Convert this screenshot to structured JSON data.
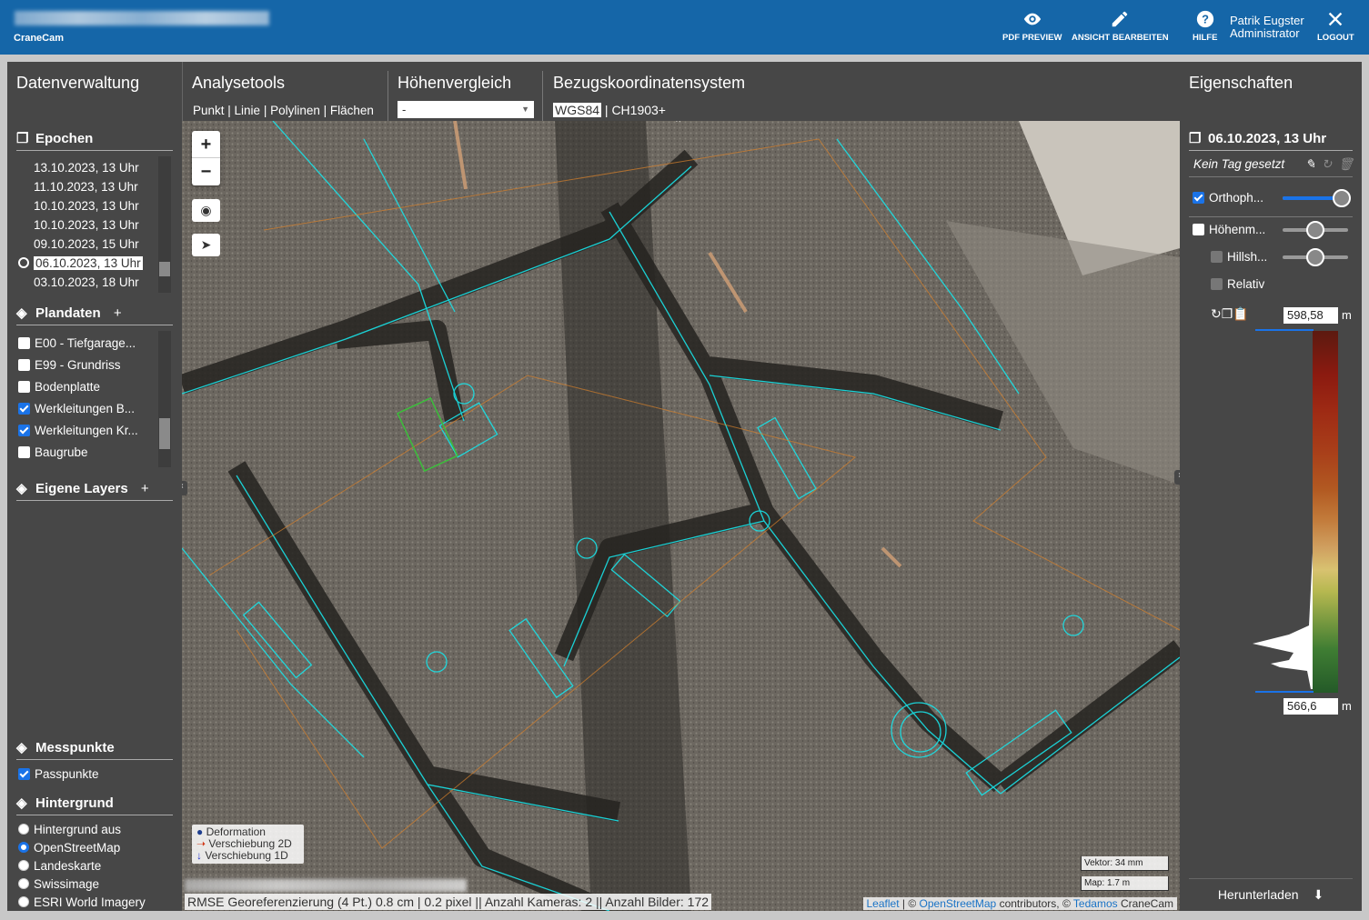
{
  "app": {
    "brand": "CraneCam"
  },
  "topbar": {
    "pdf_preview": "PDF PREVIEW",
    "edit_view": "ANSICHT BEARBEITEN",
    "help": "HILFE",
    "user_name": "Patrik Eugster",
    "user_role": "Administrator",
    "logout": "LOGOUT"
  },
  "left": {
    "title": "Datenverwaltung",
    "epochs": {
      "label": "Epochen",
      "items": [
        "13.10.2023, 13 Uhr",
        "11.10.2023, 13 Uhr",
        "10.10.2023, 13 Uhr",
        "10.10.2023, 13 Uhr",
        "09.10.2023, 15 Uhr",
        "06.10.2023, 13 Uhr",
        "03.10.2023, 18 Uhr"
      ],
      "selected_index": 5
    },
    "plans": {
      "label": "Plandaten",
      "add": "+",
      "items": [
        {
          "label": "E00 - Tiefgarage...",
          "checked": false
        },
        {
          "label": "E99 - Grundriss",
          "checked": false
        },
        {
          "label": "Bodenplatte",
          "checked": false
        },
        {
          "label": "Werkleitungen B...",
          "checked": true
        },
        {
          "label": "Werkleitungen Kr...",
          "checked": true
        },
        {
          "label": "Baugrube",
          "checked": false
        }
      ]
    },
    "own_layers": {
      "label": "Eigene Layers",
      "add": "+"
    },
    "measure": {
      "label": "Messpunkte",
      "items": [
        {
          "label": "Passpunkte",
          "checked": true
        }
      ]
    },
    "background": {
      "label": "Hintergrund",
      "items": [
        "Hintergrund aus",
        "OpenStreetMap",
        "Landeskarte",
        "Swissimage",
        "ESRI World Imagery"
      ],
      "selected_index": 1
    }
  },
  "tools": {
    "analysis": {
      "title": "Analysetools",
      "items": [
        "Punkt",
        "Linie",
        "Polylinen",
        "Flächen"
      ]
    },
    "height": {
      "title": "Höhenvergleich",
      "select_value": "-"
    },
    "crs": {
      "title": "Bezugskoordinatensystem",
      "active": "WGS84",
      "other": "CH1903+"
    }
  },
  "map": {
    "legend": [
      "Deformation",
      "Verschiebung 2D",
      "Verschiebung 1D"
    ],
    "legend_colors": [
      "#1f3f8f",
      "#d23a1a",
      "#2233cc"
    ],
    "status": "RMSE Georeferenzierung (4 Pt.) 0.8 cm | 0.2 pixel || Anzahl Kameras: 2 || Anzahl Bilder: 172",
    "scale_vector": "Vektor: 34 mm",
    "scale_map": "Map: 1.7 m",
    "attrib_leaflet": "Leaflet",
    "attrib_sep1": "| ©",
    "attrib_osm": "OpenStreetMap",
    "attrib_contrib": "contributors, ©",
    "attrib_tedamos": "Tedamos",
    "attrib_cranecam": "CraneCam"
  },
  "right": {
    "title": "Eigenschaften",
    "epoch": "06.10.2023, 13 Uhr",
    "tag": "Kein Tag gesetzt",
    "layers": [
      {
        "label": "Orthoph...",
        "checked": true,
        "opacity": 1.0
      },
      {
        "label": "Höhenm...",
        "checked": false,
        "opacity": 0.5
      },
      {
        "label": "Hillsh...",
        "checked": false,
        "opacity": 0.5
      },
      {
        "label": "Relativ",
        "checked": false
      }
    ],
    "max_value": "598,58",
    "min_value": "566,6",
    "unit": "m",
    "download": "Herunterladen"
  }
}
